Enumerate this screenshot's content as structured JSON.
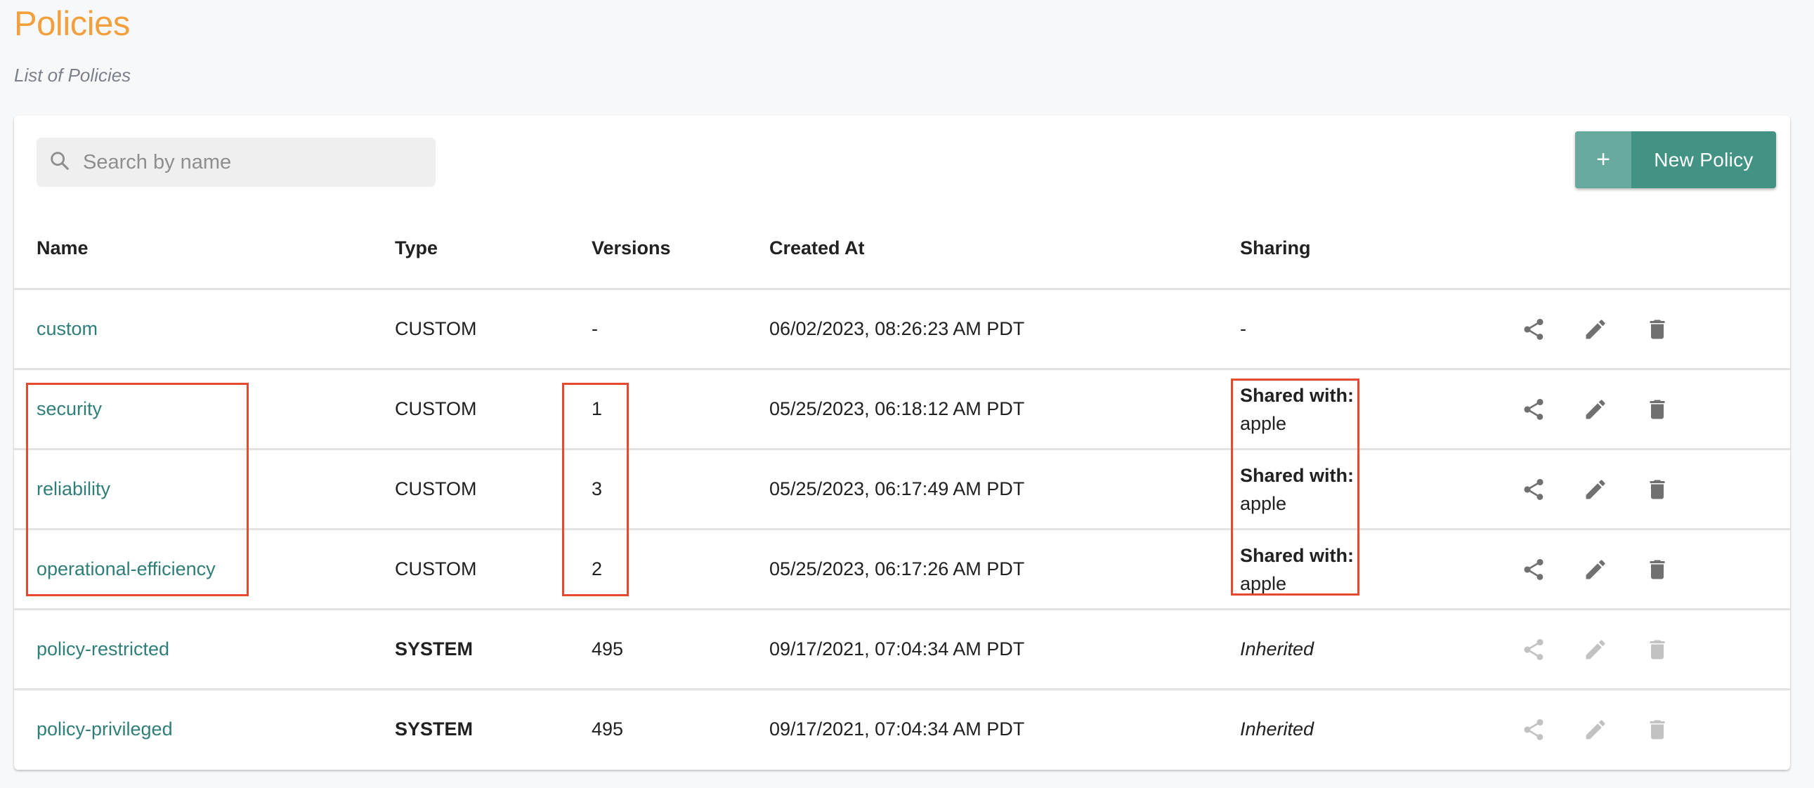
{
  "header": {
    "title": "Policies",
    "subtitle": "List of Policies"
  },
  "toolbar": {
    "search_placeholder": "Search by name",
    "search_value": "",
    "new_button_icon": "+",
    "new_button_label": "New Policy"
  },
  "table": {
    "columns": [
      "Name",
      "Type",
      "Versions",
      "Created At",
      "Sharing"
    ],
    "rows": [
      {
        "name": "custom",
        "type": "CUSTOM",
        "type_bold": false,
        "versions": "-",
        "created_at": "06/02/2023, 08:26:23 AM PDT",
        "sharing": "-",
        "sharing_kind": "none",
        "actions_enabled": true
      },
      {
        "name": "security",
        "type": "CUSTOM",
        "type_bold": false,
        "versions": "1",
        "created_at": "05/25/2023, 06:18:12 AM PDT",
        "sharing_label": "Shared with:",
        "sharing": "apple",
        "sharing_kind": "shared",
        "actions_enabled": true
      },
      {
        "name": "reliability",
        "type": "CUSTOM",
        "type_bold": false,
        "versions": "3",
        "created_at": "05/25/2023, 06:17:49 AM PDT",
        "sharing_label": "Shared with:",
        "sharing": "apple",
        "sharing_kind": "shared",
        "actions_enabled": true
      },
      {
        "name": "operational-efficiency",
        "type": "CUSTOM",
        "type_bold": false,
        "versions": "2",
        "created_at": "05/25/2023, 06:17:26 AM PDT",
        "sharing_label": "Shared with:",
        "sharing": "apple",
        "sharing_kind": "shared",
        "actions_enabled": true
      },
      {
        "name": "policy-restricted",
        "type": "SYSTEM",
        "type_bold": true,
        "versions": "495",
        "created_at": "09/17/2021, 07:04:34 AM PDT",
        "sharing": "Inherited",
        "sharing_kind": "inherited",
        "actions_enabled": false
      },
      {
        "name": "policy-privileged",
        "type": "SYSTEM",
        "type_bold": true,
        "versions": "495",
        "created_at": "09/17/2021, 07:04:34 AM PDT",
        "sharing": "Inherited",
        "sharing_kind": "inherited",
        "actions_enabled": false
      }
    ],
    "row_actions": [
      "share-icon",
      "edit-pencil-icon",
      "delete-trash-icon"
    ]
  },
  "annotations": {
    "highlight_color": "#e5492f",
    "highlighted_columns": [
      "Name",
      "Versions",
      "Sharing"
    ],
    "highlighted_rows": [
      "security",
      "reliability",
      "operational-efficiency"
    ]
  },
  "colors": {
    "title": "#f2a03d",
    "link": "#2f7f78",
    "primary_button": "#439385",
    "primary_button_icon_bg": "#68aa9e"
  }
}
